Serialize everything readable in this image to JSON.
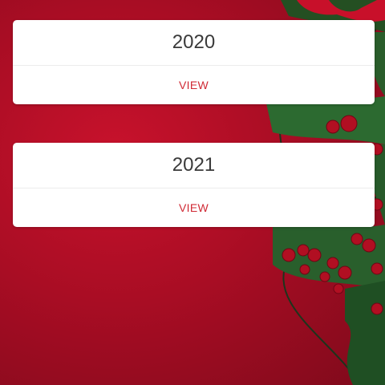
{
  "years": [
    {
      "year": "2020",
      "action_label": "VIEW"
    },
    {
      "year": "2021",
      "action_label": "VIEW"
    }
  ],
  "colors": {
    "background": "#b30f27",
    "card": "#ffffff",
    "accent": "#d02a35",
    "title_text": "#3a3a3a"
  }
}
